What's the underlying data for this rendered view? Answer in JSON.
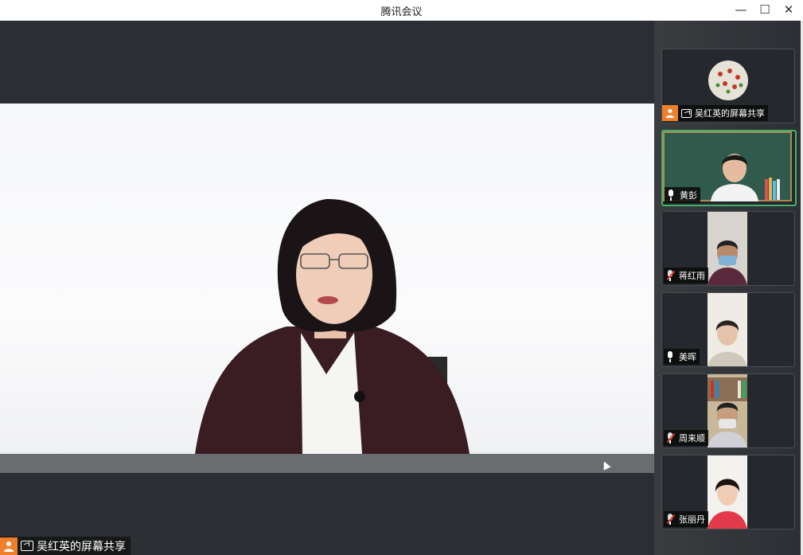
{
  "window": {
    "title": "腾讯会议",
    "minimize": "—",
    "maximize": "☐",
    "close": "✕"
  },
  "main": {
    "share_label": "吴红英的屏幕共享"
  },
  "sidebar": {
    "tiles": [
      {
        "name": "吴红英的屏幕共享",
        "mic": "none"
      },
      {
        "name": "黄彭",
        "mic": "on"
      },
      {
        "name": "蒋红雨",
        "mic": "muted"
      },
      {
        "name": "美晖",
        "mic": "on"
      },
      {
        "name": "周来顺",
        "mic": "muted"
      },
      {
        "name": "张丽丹",
        "mic": "muted"
      }
    ]
  },
  "colors": {
    "accent_orange": "#f07f2a",
    "active_speaker": "#3fb36b",
    "background": "#2b2e33"
  }
}
